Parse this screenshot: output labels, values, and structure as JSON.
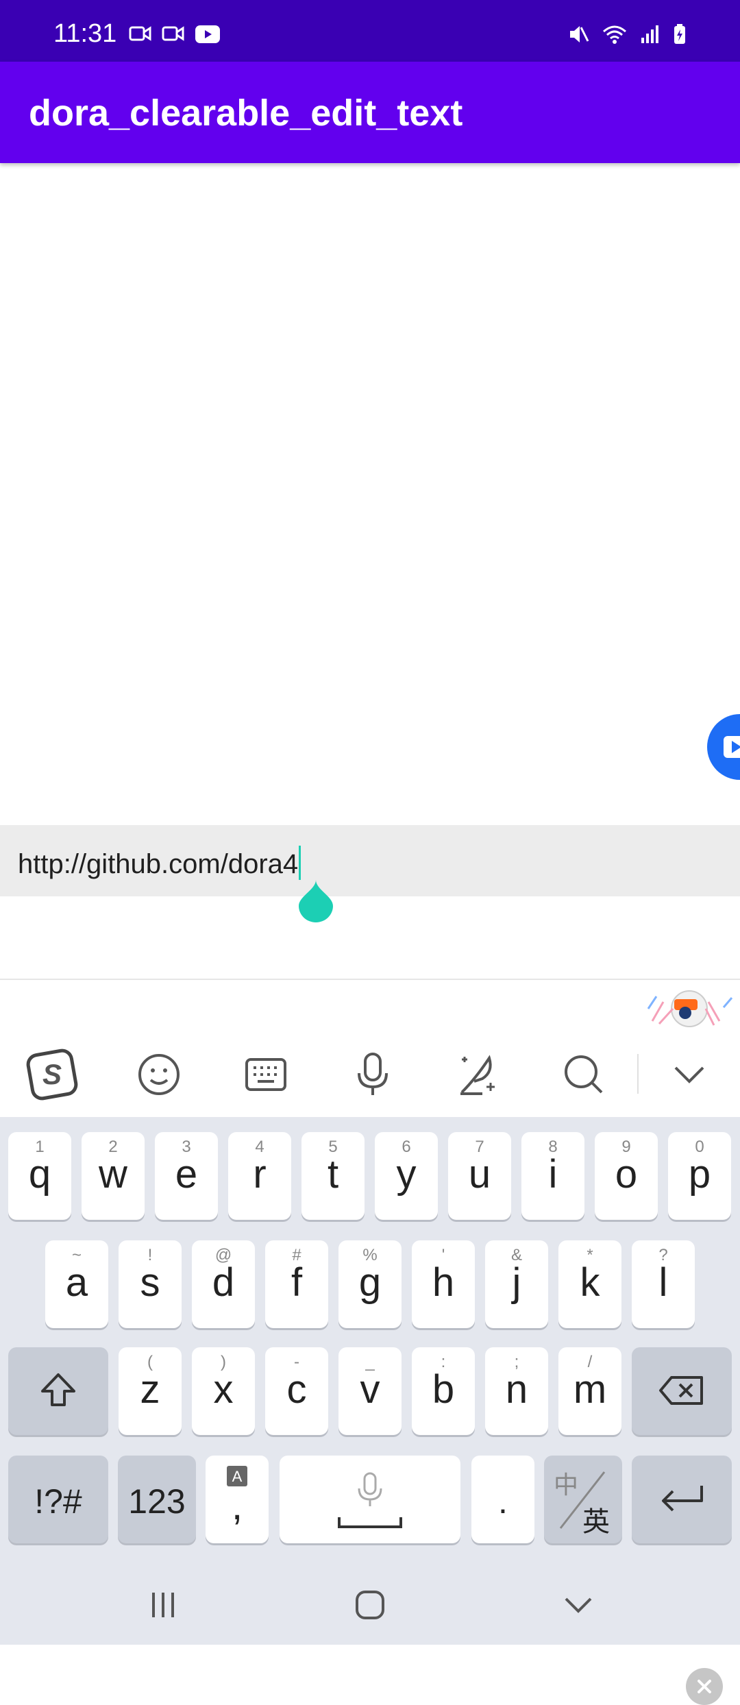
{
  "status_bar": {
    "time": "11:31"
  },
  "app_bar": {
    "title": "dora_clearable_edit_text"
  },
  "input": {
    "value": "http://github.com/dora4"
  },
  "toolbar": {
    "icons": [
      "sogou-logo-icon",
      "emoji-icon",
      "keyboard-icon",
      "mic-icon",
      "handwriting-icon",
      "search-icon",
      "collapse-icon"
    ]
  },
  "keyboard": {
    "row1": [
      {
        "main": "q",
        "sub": "1"
      },
      {
        "main": "w",
        "sub": "2"
      },
      {
        "main": "e",
        "sub": "3"
      },
      {
        "main": "r",
        "sub": "4"
      },
      {
        "main": "t",
        "sub": "5"
      },
      {
        "main": "y",
        "sub": "6"
      },
      {
        "main": "u",
        "sub": "7"
      },
      {
        "main": "i",
        "sub": "8"
      },
      {
        "main": "o",
        "sub": "9"
      },
      {
        "main": "p",
        "sub": "0"
      }
    ],
    "row2": [
      {
        "main": "a",
        "sub": "~"
      },
      {
        "main": "s",
        "sub": "!"
      },
      {
        "main": "d",
        "sub": "@"
      },
      {
        "main": "f",
        "sub": "#"
      },
      {
        "main": "g",
        "sub": "%"
      },
      {
        "main": "h",
        "sub": "'"
      },
      {
        "main": "j",
        "sub": "&"
      },
      {
        "main": "k",
        "sub": "*"
      },
      {
        "main": "l",
        "sub": "?"
      }
    ],
    "row3": [
      {
        "main": "z",
        "sub": "("
      },
      {
        "main": "x",
        "sub": ")"
      },
      {
        "main": "c",
        "sub": "-"
      },
      {
        "main": "v",
        "sub": "_"
      },
      {
        "main": "b",
        "sub": ":"
      },
      {
        "main": "n",
        "sub": ";"
      },
      {
        "main": "m",
        "sub": "/"
      }
    ],
    "symbols_label": "!?#",
    "numbers_label": "123",
    "comma_label": ",",
    "period_label": ".",
    "lang_top": "中",
    "lang_bottom": "英"
  },
  "colors": {
    "status_bar": "#3a00b3",
    "app_bar": "#6200ee",
    "caret": "#1ccfb4",
    "fab": "#1e6df5"
  }
}
